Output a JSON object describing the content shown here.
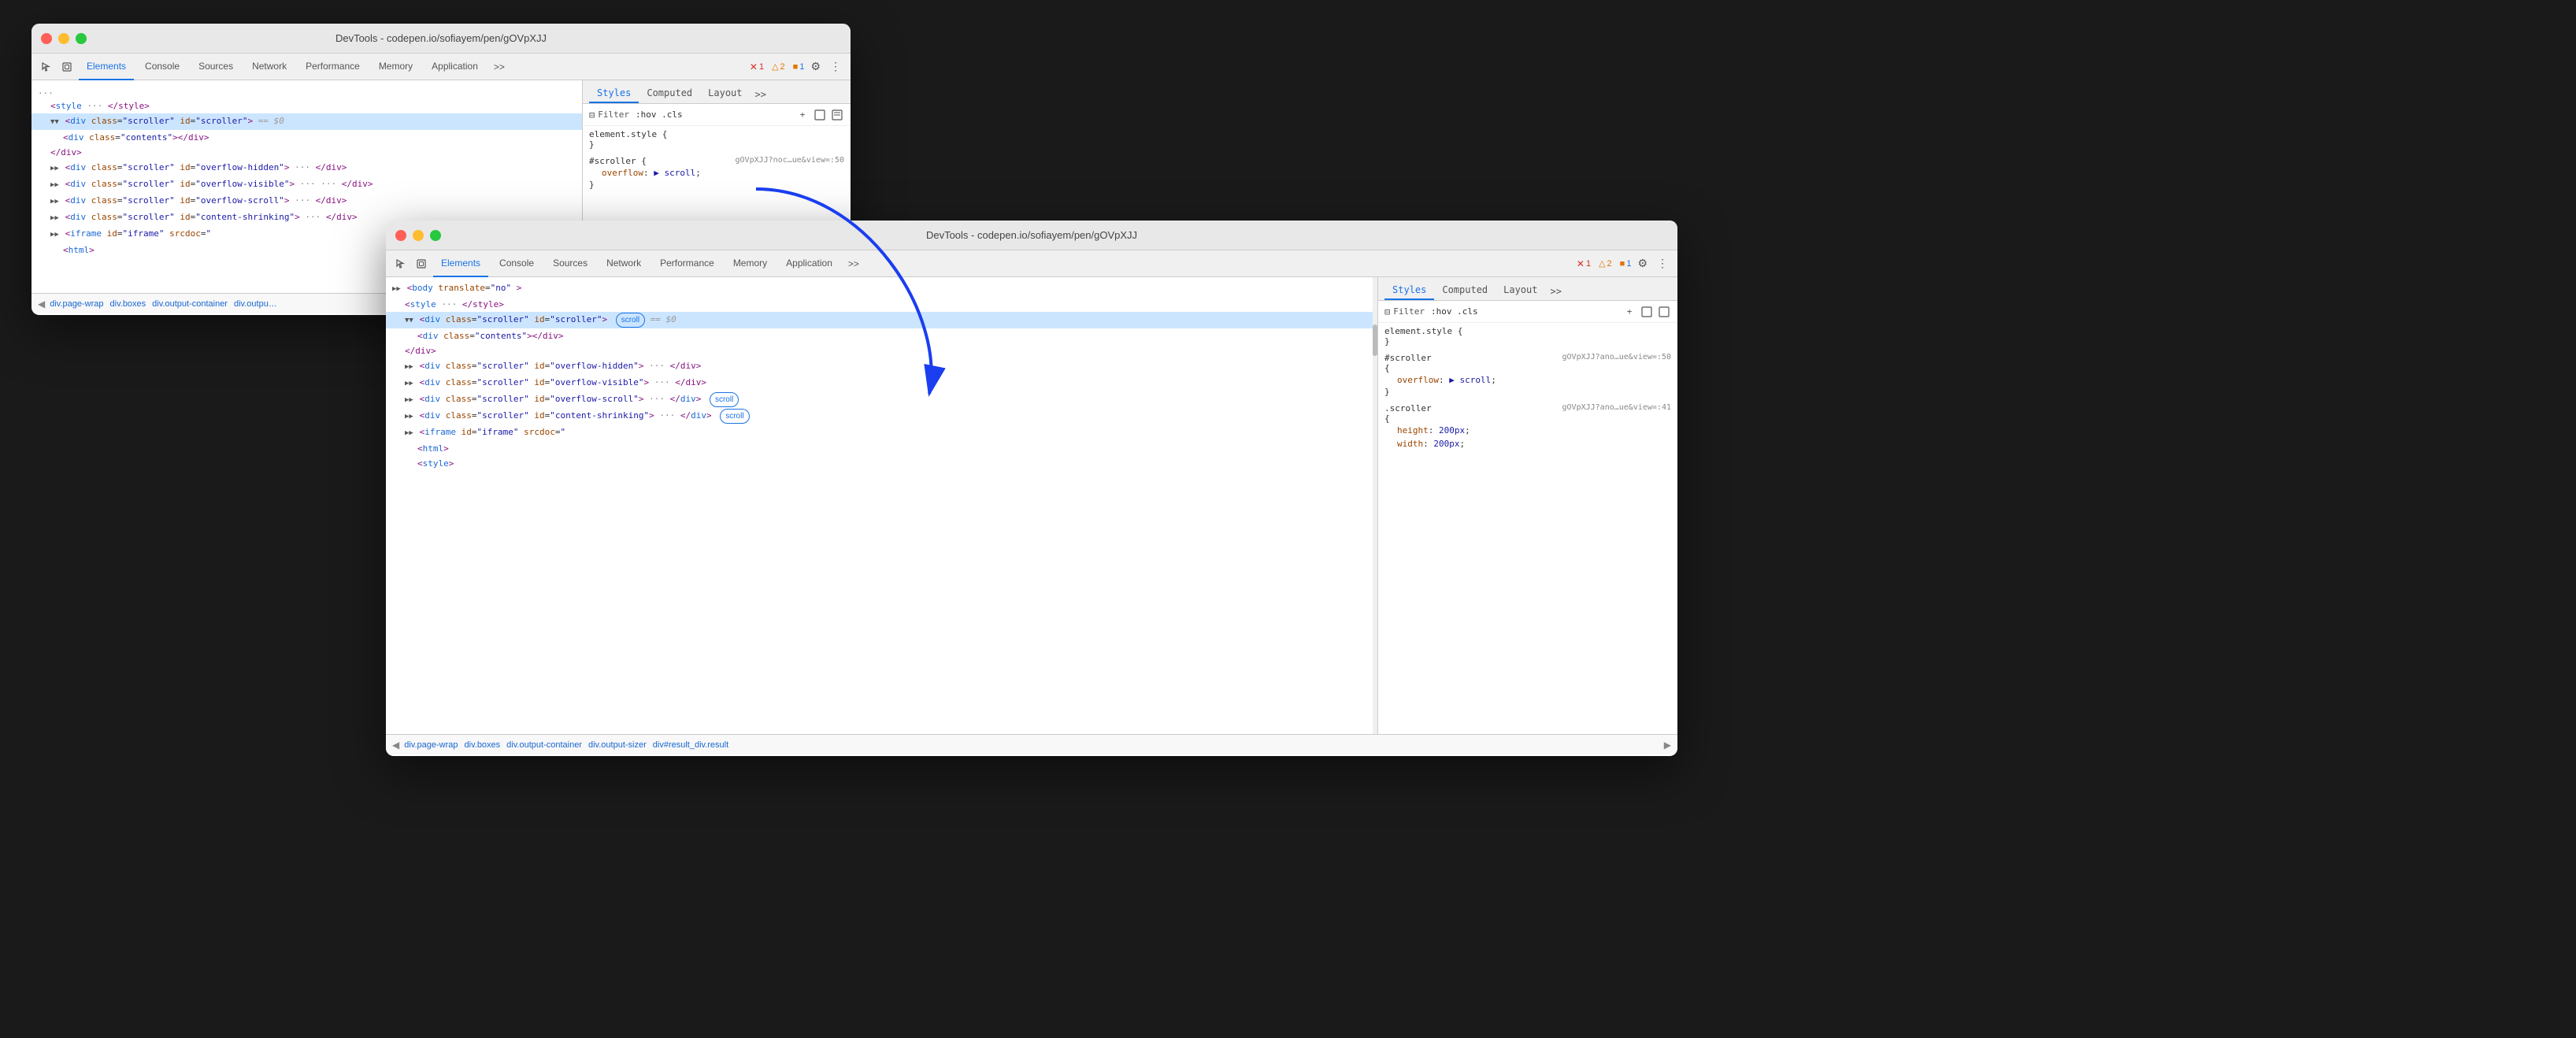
{
  "window1": {
    "title": "DevTools - codepen.io/sofiayem/pen/gOVpXJJ",
    "tabs": [
      "Elements",
      "Console",
      "Sources",
      "Network",
      "Performance",
      "Memory",
      "Application",
      ">>"
    ],
    "active_tab": "Elements",
    "badges": {
      "error": "1",
      "warn": "2",
      "info": "1"
    },
    "elements": [
      {
        "indent": 1,
        "html": "<span class='tag-open'>&lt;</span><span class='tag-name'>style</span><span class='dots-tag'> ··· </span><span class='tag-close-inline'>&lt;/style&gt;</span>"
      },
      {
        "indent": 1,
        "html": "<span class='triangle down'></span> <span class='tag-open'>&lt;</span><span class='tag-name'>div</span> <span class='attr-name'>class</span>=<span class='attr-val'>\"scroller\"</span> <span class='attr-name'>id</span>=<span class='attr-val'>\"scroller\"</span><span class='tag-open'>&gt;</span> <span class='dollar'>== $0</span>",
        "selected": true
      },
      {
        "indent": 2,
        "html": "<span class='tag-open'>&lt;</span><span class='tag-name'>div</span> <span class='attr-name'>class</span>=<span class='attr-val'>\"contents\"</span><span class='tag-open'>&gt;&lt;/div&gt;</span>"
      },
      {
        "indent": 1,
        "html": "<span class='tag-close-inline'>&lt;/div&gt;</span>"
      },
      {
        "indent": 1,
        "html": "<span class='triangle open'></span> <span class='tag-open'>&lt;</span><span class='tag-name'>div</span> <span class='attr-name'>class</span>=<span class='attr-val'>\"scroller\"</span> <span class='attr-name'>id</span>=<span class='attr-val'>\"overflow-hidden\"</span><span class='tag-open'>&gt;</span> <span class='dots-tag'>···</span> <span class='tag-close-inline'>&lt;/div&gt;</span>"
      },
      {
        "indent": 1,
        "html": "<span class='triangle open'></span> <span class='tag-open'>&lt;</span><span class='tag-name'>div</span> <span class='attr-name'>class</span>=<span class='attr-val'>\"scroller\"</span> <span class='attr-name'>id</span>=<span class='attr-val'>\"overflow-visible\"</span><span class='tag-open'>&gt;</span> <span class='dots-tag'>···</span> <span class='tag-close-inline'>&lt;/div&gt;</span>"
      },
      {
        "indent": 1,
        "html": "<span class='triangle open'></span> <span class='tag-open'>&lt;</span><span class='tag-name'>div</span> <span class='attr-name'>class</span>=<span class='attr-val'>\"scroller\"</span> <span class='attr-name'>id</span>=<span class='attr-val'>\"overflow-scroll\"</span><span class='tag-open'>&gt;</span> <span class='dots-tag'>···</span> <span class='tag-close-inline'>&lt;/div&gt;</span>"
      },
      {
        "indent": 1,
        "html": "<span class='triangle open'></span> <span class='tag-open'>&lt;</span><span class='tag-name'>div</span> <span class='attr-name'>class</span>=<span class='attr-val'>\"scroller\"</span> <span class='attr-name'>id</span>=<span class='attr-val'>\"content-shrinking\"</span><span class='tag-open'>&gt;</span> <span class='dots-tag'>···</span> <span class='tag-close-inline'>&lt;/div&gt;</span>"
      },
      {
        "indent": 1,
        "html": "<span class='triangle open'></span> <span class='tag-open'>&lt;</span><span class='tag-name'>iframe</span> <span class='attr-name'>id</span>=<span class='attr-val'>\"iframe\"</span> <span class='attr-name'>srcdoc</span>=<span class='attr-val'>\"</span>"
      },
      {
        "indent": 2,
        "html": "<span class='tag-open'>&lt;</span><span class='tag-name'>html</span><span class='tag-open'>&gt;</span>"
      }
    ],
    "breadcrumbs": [
      "div.page-wrap",
      "div.boxes",
      "div.output-container",
      "div.outpu…"
    ],
    "styles": {
      "tabs": [
        "Styles",
        "Computed",
        "Layout",
        ">>"
      ],
      "active_tab": "Styles",
      "filter_placeholder": ":hov .cls",
      "rules": [
        {
          "selector": "element.style {",
          "close": "}",
          "source": "",
          "props": []
        },
        {
          "selector": "#scroller {",
          "close": "}",
          "source": "gOVpXJJ?noc…ue&view=:50",
          "props": [
            {
              "name": "overflow",
              "colon": ":",
              "val": " ▶ scroll",
              "arrow": true
            }
          ]
        }
      ]
    }
  },
  "window2": {
    "title": "DevTools - codepen.io/sofiayem/pen/gOVpXJJ",
    "tabs": [
      "Elements",
      "Console",
      "Sources",
      "Network",
      "Performance",
      "Memory",
      "Application",
      ">>"
    ],
    "active_tab": "Elements",
    "badges": {
      "error": "1",
      "warn": "2",
      "info": "1"
    },
    "elements": [
      {
        "indent": 1,
        "html_key": "style",
        "text": "<style> ··· </style>"
      },
      {
        "indent": 1,
        "html_key": "scroller_div",
        "text": "<div class=\"scroller\" id=\"scroller\"",
        "badge": "scroll",
        "suffix": " == $0",
        "selected": true
      },
      {
        "indent": 2,
        "html_key": "contents_div",
        "text": "<div class=\"contents\"></div>"
      },
      {
        "indent": 1,
        "html_key": "close_div",
        "text": "</div>"
      },
      {
        "indent": 1,
        "html_key": "overflow_hidden",
        "text": "<div class=\"scroller\" id=\"overflow-hidden\"> ··· </div>"
      },
      {
        "indent": 1,
        "html_key": "overflow_visible",
        "text": "<div class=\"scroller\" id=\"overflow-visible\"> ··· </div>"
      },
      {
        "indent": 1,
        "html_key": "overflow_scroll",
        "text": "<div class=\"scroller\" id=\"overflow-scroll\"> ···",
        "badge": "scroll",
        "suffix": "</div>",
        "badge2": "scroll"
      },
      {
        "indent": 1,
        "html_key": "content_shrinking",
        "text": "<div class=\"scroller\" id=\"content-shrinking\"> ···",
        "suffix": "</div>",
        "badge": "scroll"
      },
      {
        "indent": 1,
        "html_key": "iframe",
        "text": "<iframe id=\"iframe\" srcdoc=\""
      },
      {
        "indent": 2,
        "html_key": "html",
        "text": "<html>"
      },
      {
        "indent": 1,
        "html_key": "style2",
        "text": "<style>"
      }
    ],
    "breadcrumbs": [
      "div.page-wrap",
      "div.boxes",
      "div.output-container",
      "div.output-sizer",
      "div#result_div.result"
    ],
    "styles": {
      "tabs": [
        "Styles",
        "Computed",
        "Layout",
        ">>"
      ],
      "active_tab": "Styles",
      "filter_placeholder": ":hov .cls",
      "rules": [
        {
          "selector": "element.style {",
          "close": "}",
          "source": "",
          "props": []
        },
        {
          "selector": "#scroller",
          "open": "{",
          "close": "}",
          "source": "gOVpXJJ?ano…ue&view=:50",
          "props": [
            {
              "name": "overflow",
              "colon": ":",
              "val": " ▶ scroll;",
              "arrow": true
            }
          ]
        },
        {
          "selector": ".scroller",
          "open": "{",
          "close": "}",
          "source": "gOVpXJJ?ano…ue&view=:41",
          "props": [
            {
              "name": "height",
              "colon": ":",
              "val": " 200px;",
              "arrow": false
            },
            {
              "name": "width",
              "colon": ":",
              "val": " 200px;",
              "arrow": false
            }
          ]
        }
      ]
    }
  },
  "arrow": {
    "color": "#1a3ef0",
    "label": "annotation arrow from window1 to window2"
  },
  "icons": {
    "cursor": "⬚",
    "box": "⊡",
    "filter": "⊟",
    "gear": "⚙",
    "dots": "⋮",
    "err_circle": "✕",
    "warn_tri": "△",
    "info_sq": "■",
    "toggle_hov": ":hov",
    "toggle_cls": ".cls",
    "plus": "+",
    "box_model": "⊞",
    "indent_icon": "↹",
    "more": "»"
  }
}
